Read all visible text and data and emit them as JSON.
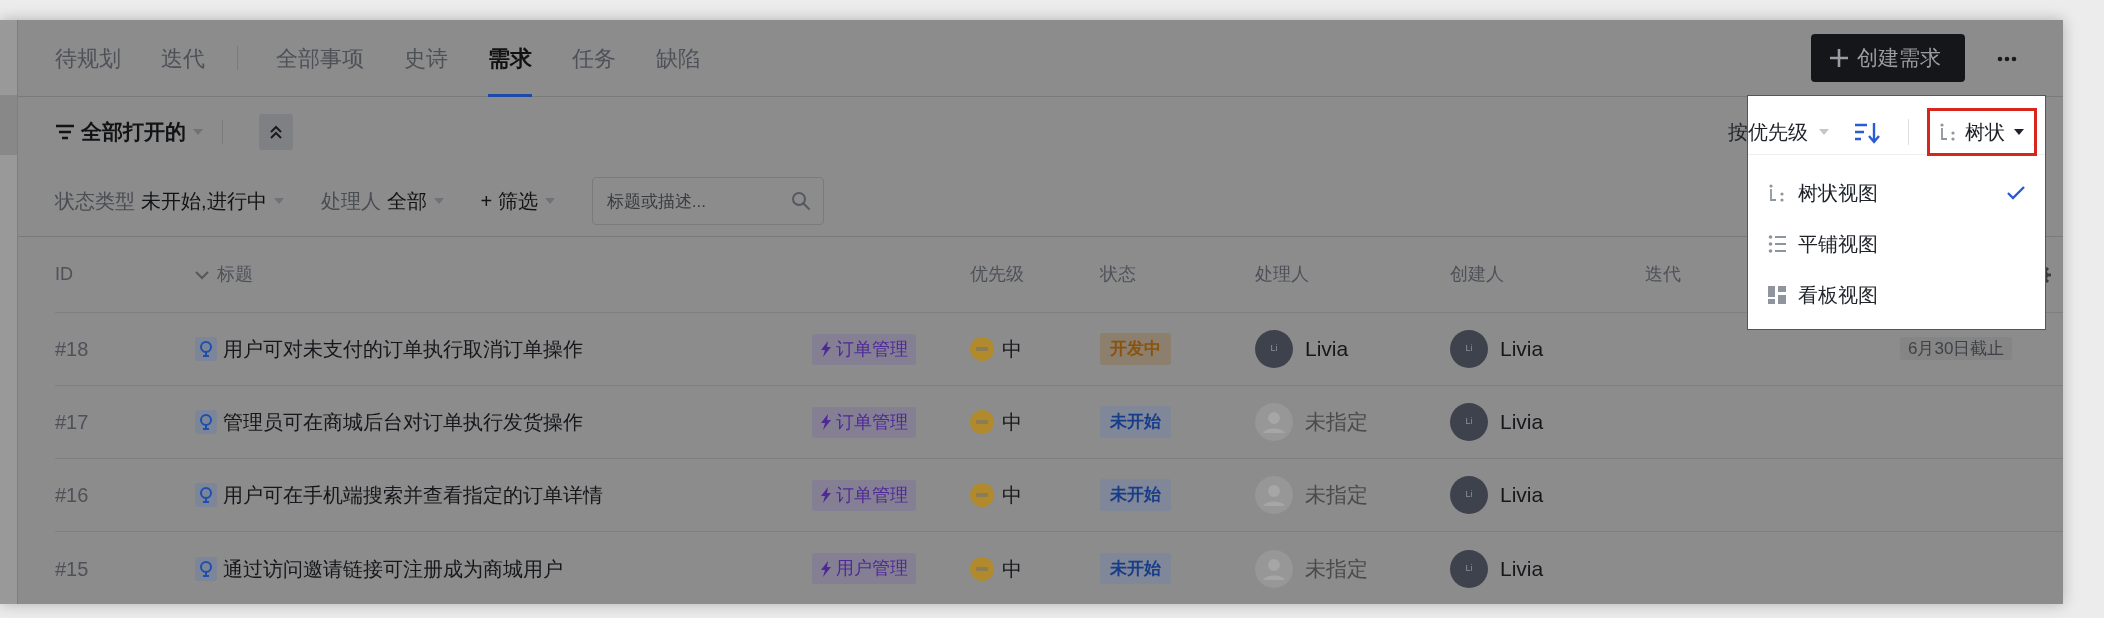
{
  "tab_groups": [
    {
      "tabs": [
        {
          "label": "待规划",
          "selected": false
        },
        {
          "label": "迭代",
          "selected": false
        }
      ]
    },
    {
      "tabs": [
        {
          "label": "全部事项",
          "selected": false
        },
        {
          "label": "史诗",
          "selected": false
        },
        {
          "label": "需求",
          "selected": true
        },
        {
          "label": "任务",
          "selected": false
        },
        {
          "label": "缺陷",
          "selected": false
        }
      ]
    }
  ],
  "create_button": {
    "label": "创建需求"
  },
  "saved_view": {
    "label": "全部打开的"
  },
  "filters": [
    {
      "kind": "field",
      "label": "状态类型",
      "value": "未开始,进行中"
    },
    {
      "kind": "field",
      "label": "处理人",
      "value": "全部"
    },
    {
      "kind": "add",
      "label": "+ 筛选"
    }
  ],
  "search": {
    "placeholder": "标题或描述..."
  },
  "sort": {
    "label": "按优先级"
  },
  "view_toggle": {
    "label": "树状",
    "highlighted": true
  },
  "view_menu": [
    {
      "kind": "tree",
      "label": "树状视图",
      "selected": true
    },
    {
      "kind": "list",
      "label": "平铺视图",
      "selected": false
    },
    {
      "kind": "board",
      "label": "看板视图",
      "selected": false
    }
  ],
  "table": {
    "columns": [
      "ID",
      "标题",
      "优先级",
      "状态",
      "处理人",
      "创建人",
      "迭代"
    ],
    "rows": [
      {
        "id": "#18",
        "title": "用户可对未支付的订单执行取消订单操作",
        "tag": "订单管理",
        "priority": "中",
        "status": {
          "label": "开发中",
          "kind": "in_progress"
        },
        "assignee": {
          "assigned": true,
          "name": "Livia",
          "initials": "Li"
        },
        "creator": {
          "name": "Livia",
          "initials": "Li"
        },
        "due": "6月30日截止"
      },
      {
        "id": "#17",
        "title": "管理员可在商城后台对订单执行发货操作",
        "tag": "订单管理",
        "priority": "中",
        "status": {
          "label": "未开始",
          "kind": "not_started"
        },
        "assignee": {
          "assigned": false,
          "name": "未指定"
        },
        "creator": {
          "name": "Livia",
          "initials": "Li"
        }
      },
      {
        "id": "#16",
        "title": "用户可在手机端搜索并查看指定的订单详情",
        "tag": "订单管理",
        "priority": "中",
        "status": {
          "label": "未开始",
          "kind": "not_started"
        },
        "assignee": {
          "assigned": false,
          "name": "未指定"
        },
        "creator": {
          "name": "Livia",
          "initials": "Li"
        }
      },
      {
        "id": "#15",
        "title": "通过访问邀请链接可注册成为商城用户",
        "tag": "用户管理",
        "priority": "中",
        "status": {
          "label": "未开始",
          "kind": "not_started"
        },
        "assignee": {
          "assigned": false,
          "name": "未指定"
        },
        "creator": {
          "name": "Livia",
          "initials": "Li"
        }
      }
    ]
  }
}
